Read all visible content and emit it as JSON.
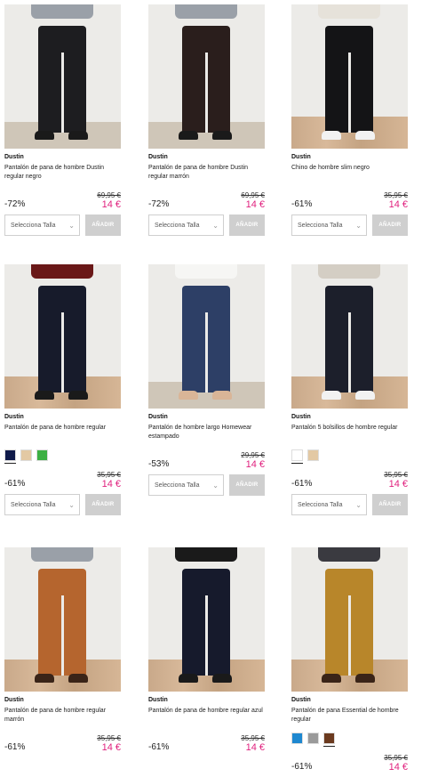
{
  "products": [
    {
      "brand": "Dustin",
      "title": "Pantalón de pana de hombre Dustin regular negro",
      "old_price": "69,95 €",
      "discount": "-72%",
      "new_price": "14 €",
      "size_placeholder": "Selecciona Talla",
      "add_label": "AÑADIR",
      "pants_color": "#1d1d20",
      "top_color": "#9aa0a8",
      "shoe_color": "#1a1a1a",
      "floor": "plain"
    },
    {
      "brand": "Dustin",
      "title": "Pantalón de pana de hombre Dustin regular marrón",
      "old_price": "69,95 €",
      "discount": "-72%",
      "new_price": "14 €",
      "size_placeholder": "Selecciona Talla",
      "add_label": "AÑADIR",
      "pants_color": "#2a1e1c",
      "top_color": "#9aa0a8",
      "shoe_color": "#1a1a1a",
      "floor": "plain"
    },
    {
      "brand": "Dustin",
      "title": "Chino de hombre slim negro",
      "old_price": "35,95 €",
      "discount": "-61%",
      "new_price": "14 €",
      "size_placeholder": "Selecciona Talla",
      "add_label": "AÑADIR",
      "pants_color": "#141416",
      "top_color": "#e6e2da",
      "shoe_color": "#f2f2f2",
      "floor": "wood"
    },
    {
      "brand": "Dustin",
      "title": "Pantalón de pana de hombre regular",
      "swatches": [
        "#0f1a4a",
        "#e3c9a4",
        "#3cb043"
      ],
      "selected_swatch": 0,
      "old_price": "35,95 €",
      "discount": "-61%",
      "new_price": "14 €",
      "size_placeholder": "Selecciona Talla",
      "add_label": "AÑADIR",
      "pants_color": "#171b2b",
      "top_color": "#6a1818",
      "shoe_color": "#1a1a1a",
      "floor": "wood"
    },
    {
      "brand": "Dustin",
      "title": "Pantalón de hombre largo Homewear estampado",
      "old_price": "29,95 €",
      "discount": "-53%",
      "new_price": "14 €",
      "size_placeholder": "Selecciona Talla",
      "add_label": "AÑADIR",
      "pants_color": "#2d3f66",
      "top_color": "#f6f6f4",
      "shoe_color": "#d9b597",
      "floor": "plain"
    },
    {
      "brand": "Dustin",
      "title": "Pantalón 5 bolsillos de hombre regular",
      "swatches": [
        "#ffffff",
        "#e3c9a4"
      ],
      "selected_swatch": 0,
      "old_price": "35,95 €",
      "discount": "-61%",
      "new_price": "14 €",
      "size_placeholder": "Selecciona Talla",
      "add_label": "AÑADIR",
      "pants_color": "#1c1f2b",
      "top_color": "#d4cec4",
      "shoe_color": "#f2f2f2",
      "floor": "wood"
    },
    {
      "brand": "Dustin",
      "title": "Pantalón de pana de hombre regular marrón",
      "old_price": "35,95 €",
      "discount": "-61%",
      "new_price": "14 €",
      "pants_color": "#b5652e",
      "top_color": "#9aa0a8",
      "shoe_color": "#3a2418",
      "floor": "wood"
    },
    {
      "brand": "Dustin",
      "title": "Pantalón de pana de hombre regular azul",
      "old_price": "35,95 €",
      "discount": "-61%",
      "new_price": "14 €",
      "pants_color": "#161a2c",
      "top_color": "#1a1a1a",
      "shoe_color": "#1a1a1a",
      "floor": "wood"
    },
    {
      "brand": "Dustin",
      "title": "Pantalón de pana Essential de hombre regular",
      "swatches": [
        "#1e88d0",
        "#9a9a9a",
        "#6b3a1f"
      ],
      "selected_swatch": 2,
      "old_price": "35,95 €",
      "discount": "-61%",
      "new_price": "14 €",
      "pants_color": "#b8862a",
      "top_color": "#3a3a40",
      "shoe_color": "#3a2418",
      "floor": "wood"
    }
  ]
}
